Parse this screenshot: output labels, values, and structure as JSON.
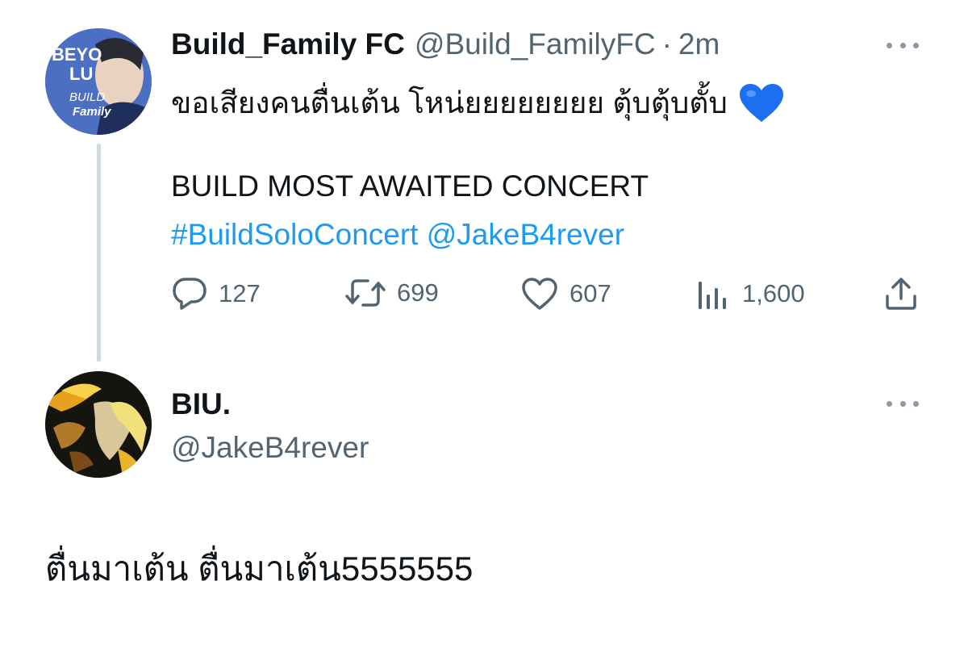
{
  "parent_tweet": {
    "display_name": "Build_Family FC",
    "handle": "@Build_FamilyFC",
    "separator": "·",
    "time": "2m",
    "text_line1": "ขอเสียงคนตื่นเต้น โหน่ยยยยยยยย ตุ้บตุ้บตั้บ",
    "emoji": "💙",
    "text_line2": "BUILD MOST AWAITED CONCERT",
    "hashtag": "#BuildSoloConcert",
    "mention": "@JakeB4rever",
    "avatar_text": {
      "l1": "BEYO",
      "l2": "LU",
      "l3": "BUILD",
      "l4": "Family"
    },
    "actions": {
      "replies": "127",
      "retweets": "699",
      "likes": "607",
      "views": "1,600"
    }
  },
  "reply_tweet": {
    "display_name": "BIU.",
    "handle": "@JakeB4rever",
    "text": "ตื่นมาเต้น ตื่นมาเต้น5555555"
  },
  "colors": {
    "link": "#1d9bf0",
    "secondary_text": "#536471",
    "thread_line": "#cfd9de"
  }
}
